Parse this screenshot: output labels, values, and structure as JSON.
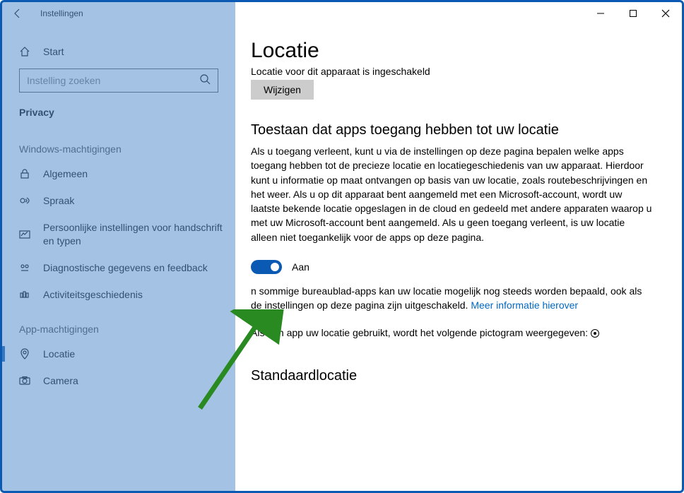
{
  "titlebar": {
    "title": "Instellingen"
  },
  "sidebar": {
    "start_label": "Start",
    "search_placeholder": "Instelling zoeken",
    "category": "Privacy",
    "section1_label": "Windows-machtigingen",
    "section2_label": "App-machtigingen",
    "items1": [
      {
        "label": "Algemeen"
      },
      {
        "label": "Spraak"
      },
      {
        "label": "Persoonlijke instellingen voor handschrift en typen"
      },
      {
        "label": "Diagnostische gegevens en feedback"
      },
      {
        "label": "Activiteitsgeschiedenis"
      }
    ],
    "items2": [
      {
        "label": "Locatie"
      },
      {
        "label": "Camera"
      }
    ]
  },
  "content": {
    "page_title": "Locatie",
    "device_status_partial": "Locatie voor dit apparaat is ingeschakeld",
    "change_button": "Wijzigen",
    "allow_heading": "Toestaan dat apps toegang hebben tot uw locatie",
    "allow_body": "Als u toegang verleent, kunt u via de instellingen op deze pagina bepalen welke apps toegang hebben tot de precieze locatie en locatiegeschiedenis van uw apparaat. Hierdoor kunt u informatie op maat ontvangen op basis van uw locatie, zoals routebeschrijvingen en het weer. Als u op dit apparaat bent aangemeld met een Microsoft-account, wordt uw laatste bekende locatie opgeslagen in de cloud en gedeeld met andere apparaten waarop u met uw Microsoft-account bent aangemeld. Als u geen toegang verleent, is uw locatie alleen niet toegankelijk voor de apps op deze pagina.",
    "toggle_state": "Aan",
    "desktop_note_prefix": "n sommige bureaublad-apps kan uw locatie mogelijk nog steeds worden bepaald, ook als de instellingen op deze pagina zijn uitgeschakeld. ",
    "desktop_note_link": "Meer informatie hierover",
    "app_uses_note": "Als een app uw locatie gebruikt, wordt het volgende pictogram weergegeven: ",
    "default_heading": "Standaardlocatie"
  }
}
